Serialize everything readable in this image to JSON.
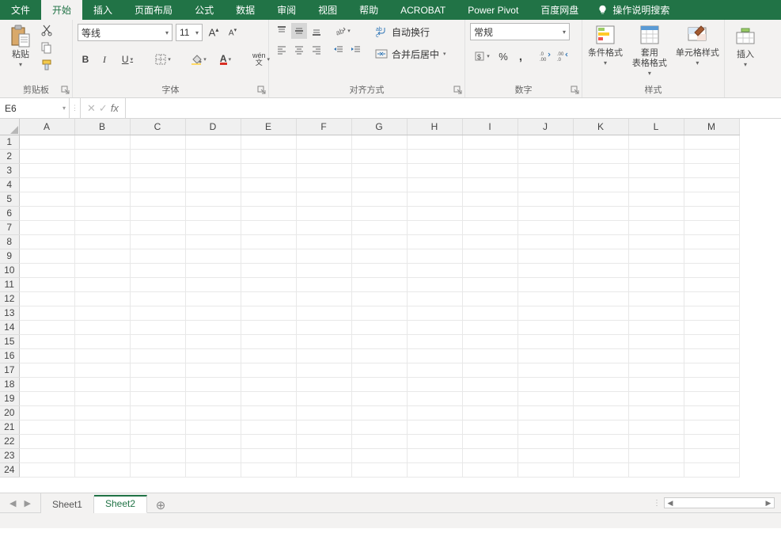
{
  "tabs": {
    "file": "文件",
    "home": "开始",
    "insert": "插入",
    "layout": "页面布局",
    "formulas": "公式",
    "data": "数据",
    "review": "审阅",
    "view": "视图",
    "help": "帮助",
    "acrobat": "ACROBAT",
    "powerpivot": "Power Pivot",
    "baidu": "百度网盘",
    "tellme": "操作说明搜索"
  },
  "ribbon": {
    "clipboard": {
      "label": "剪贴板",
      "paste": "粘贴"
    },
    "font": {
      "label": "字体",
      "name": "等线",
      "size": "11",
      "bold": "B",
      "italic": "I",
      "underline": "U",
      "wen": "wén\n文"
    },
    "align": {
      "label": "对齐方式",
      "wrap": "自动换行",
      "merge": "合并后居中"
    },
    "number": {
      "label": "数字",
      "format": "常规",
      "pct": "%",
      "comma": ","
    },
    "styles": {
      "label": "样式",
      "cond": "条件格式",
      "format_table": "套用\n表格格式",
      "cell_styles": "单元格样式"
    },
    "cells": {
      "insert": "插入"
    }
  },
  "formula_bar": {
    "name_box": "E6",
    "cancel": "✕",
    "enter": "✓",
    "fx": "fx",
    "value": ""
  },
  "grid": {
    "columns": [
      "A",
      "B",
      "C",
      "D",
      "E",
      "F",
      "G",
      "H",
      "I",
      "J",
      "K",
      "L",
      "M"
    ],
    "rows": [
      "1",
      "2",
      "3",
      "4",
      "5",
      "6",
      "7",
      "8",
      "9",
      "10",
      "11",
      "12",
      "13",
      "14",
      "15",
      "16",
      "17",
      "18",
      "19",
      "20",
      "21",
      "22",
      "23",
      "24"
    ]
  },
  "sheet_tabs": {
    "s1": "Sheet1",
    "s2": "Sheet2"
  }
}
